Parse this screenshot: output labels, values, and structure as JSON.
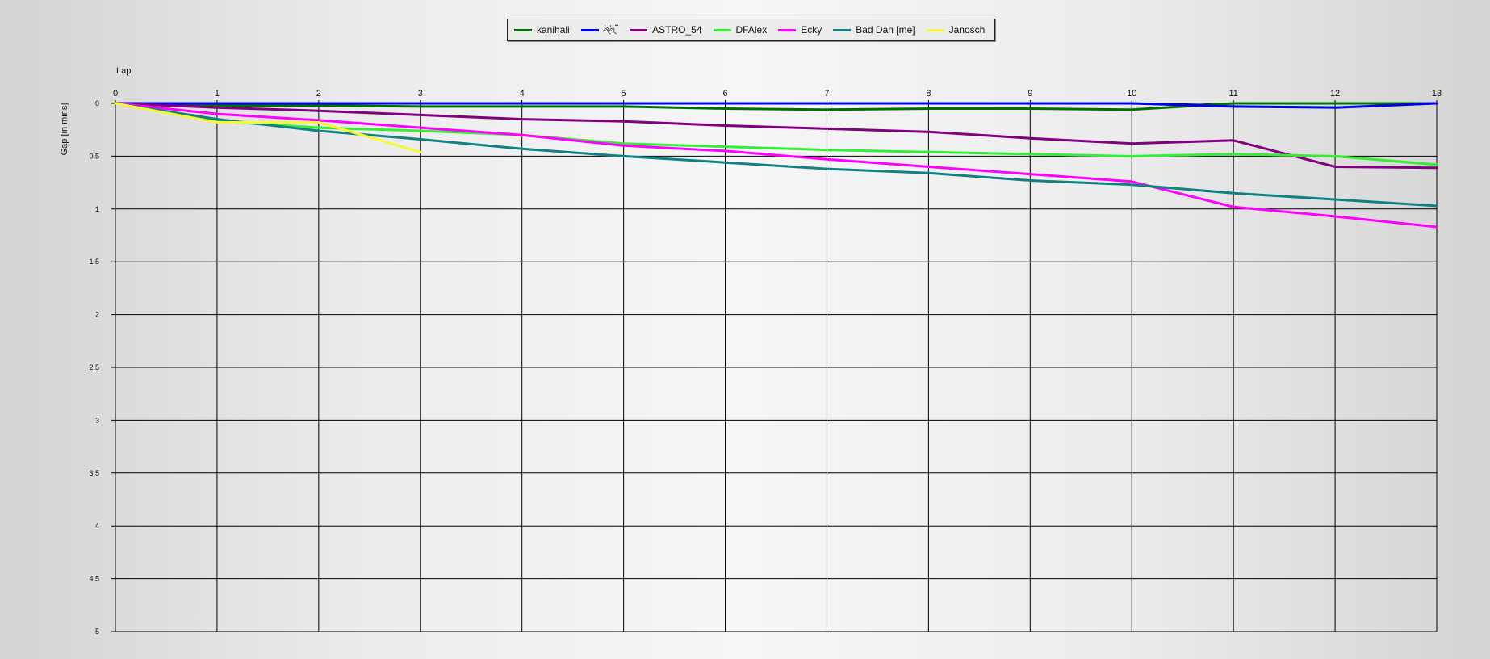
{
  "chart_data": {
    "type": "line",
    "xlabel": "Lap",
    "ylabel": "Gap [in mins]",
    "xlim": [
      0,
      13
    ],
    "ylim": [
      0,
      5
    ],
    "y_inverted": true,
    "grid": true,
    "legend_position": "top-center",
    "x_ticks": [
      "0",
      "1",
      "2",
      "3",
      "4",
      "5",
      "6",
      "7",
      "8",
      "9",
      "10",
      "11",
      "12",
      "13"
    ],
    "y_ticks": [
      "0",
      "0.5",
      "1",
      "1.5",
      "2",
      "2.5",
      "3",
      "3.5",
      "4",
      "4.5",
      "5"
    ],
    "series": [
      {
        "name": "kanihali",
        "color": "#007000",
        "x": [
          0,
          1,
          2,
          3,
          4,
          5,
          6,
          7,
          8,
          9,
          10,
          11,
          12,
          13
        ],
        "values": [
          0,
          0.02,
          0.02,
          0.03,
          0.03,
          0.03,
          0.05,
          0.06,
          0.05,
          0.05,
          0.06,
          0.0,
          0.0,
          0.0
        ]
      },
      {
        "name": "ঌ্ঌ্˜",
        "color": "#0000e6",
        "x": [
          0,
          1,
          2,
          3,
          4,
          5,
          6,
          7,
          8,
          9,
          10,
          11,
          12,
          13
        ],
        "values": [
          0,
          0,
          0,
          0,
          0,
          0,
          0,
          0,
          0,
          0,
          0,
          0.03,
          0.04,
          0.0
        ]
      },
      {
        "name": "ASTRO_54",
        "color": "#800080",
        "x": [
          0,
          1,
          2,
          3,
          4,
          5,
          6,
          7,
          8,
          9,
          10,
          11,
          12,
          13
        ],
        "values": [
          0,
          0.04,
          0.07,
          0.11,
          0.15,
          0.17,
          0.21,
          0.24,
          0.27,
          0.33,
          0.38,
          0.35,
          0.6,
          0.61
        ]
      },
      {
        "name": "DFAlex",
        "color": "#33ee33",
        "x": [
          0,
          1,
          2,
          3,
          4,
          5,
          6,
          7,
          8,
          9,
          10,
          11,
          12,
          13
        ],
        "values": [
          0,
          0.17,
          0.23,
          0.26,
          0.3,
          0.38,
          0.41,
          0.44,
          0.46,
          0.48,
          0.5,
          0.48,
          0.5,
          0.58
        ]
      },
      {
        "name": "Ecky",
        "color": "#ff00ff",
        "x": [
          0,
          1,
          2,
          3,
          4,
          5,
          6,
          7,
          8,
          9,
          10,
          11,
          12,
          13
        ],
        "values": [
          0,
          0.1,
          0.16,
          0.23,
          0.3,
          0.4,
          0.45,
          0.53,
          0.6,
          0.67,
          0.74,
          0.98,
          1.07,
          1.17
        ]
      },
      {
        "name": "Bad Dan [me]",
        "color": "#108080",
        "x": [
          0,
          1,
          2,
          3,
          4,
          5,
          6,
          7,
          8,
          9,
          10,
          11,
          12,
          13
        ],
        "values": [
          0,
          0.15,
          0.26,
          0.34,
          0.43,
          0.5,
          0.56,
          0.62,
          0.66,
          0.73,
          0.77,
          0.85,
          0.91,
          0.97
        ]
      },
      {
        "name": "Janosch",
        "color": "#f7f733",
        "x": [
          0,
          1,
          2,
          3
        ],
        "values": [
          0,
          0.18,
          0.18,
          0.46
        ]
      }
    ]
  }
}
